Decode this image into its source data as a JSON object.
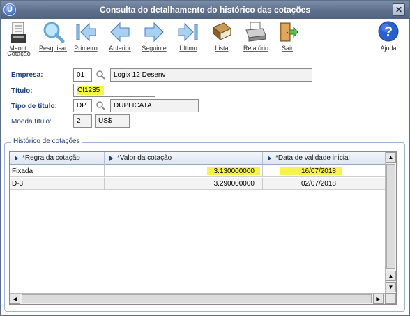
{
  "window": {
    "title": "Consulta do detalhamento do histórico das cotações"
  },
  "toolbar": {
    "buttons": [
      {
        "label": "Manut.\nCotação",
        "icon": "report-icon"
      },
      {
        "label": "Pesquisar",
        "icon": "magnifier-icon"
      },
      {
        "label": "Primeiro",
        "icon": "first-arrow-icon"
      },
      {
        "label": "Anterior",
        "icon": "prev-arrow-icon"
      },
      {
        "label": "Seguinte",
        "icon": "next-arrow-icon"
      },
      {
        "label": "Último",
        "icon": "last-arrow-icon"
      },
      {
        "label": "Lista",
        "icon": "book-icon"
      },
      {
        "label": "Relatório",
        "icon": "printer-icon"
      },
      {
        "label": "Sair",
        "icon": "exit-door-icon"
      },
      {
        "label": "Ajuda",
        "icon": "help-icon"
      }
    ]
  },
  "form": {
    "empresa": {
      "label": "Empresa:",
      "code": "01",
      "desc": "Logix 12 Desenv"
    },
    "titulo": {
      "label": "Título:",
      "value": "CI1235"
    },
    "tipo_titulo": {
      "label": "Tipo de título:",
      "code": "DP",
      "desc": "DUPLICATA"
    },
    "moeda_titulo": {
      "label": "Moeda título:",
      "code": "2",
      "desc": "US$"
    }
  },
  "group": {
    "title": "Histórico de cotações"
  },
  "grid": {
    "columns": [
      "*Regra da cotação",
      "*Valor da cotação",
      "*Data de validade inicial"
    ],
    "rows": [
      {
        "regra": "Fixada",
        "valor": "3.130000000",
        "data": "16/07/2018"
      },
      {
        "regra": "D-3",
        "valor": "3.290000000",
        "data": "02/07/2018"
      }
    ]
  },
  "colors": {
    "titlebar": "#5d6f8c",
    "label": "#1c3f7a",
    "highlight": "#f6f34a"
  }
}
